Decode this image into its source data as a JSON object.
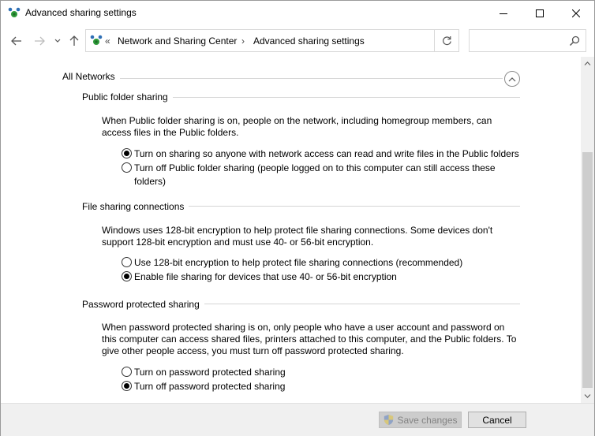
{
  "window": {
    "title": "Advanced sharing settings"
  },
  "address": {
    "overflow": "«",
    "crumbs": [
      "Network and Sharing Center",
      "Advanced sharing settings"
    ],
    "separator": "›"
  },
  "search": {
    "value": "",
    "placeholder": ""
  },
  "profile": {
    "title": "All Networks"
  },
  "sections": [
    {
      "title": "Public folder sharing",
      "description": "When Public folder sharing is on, people on the network, including homegroup members, can access files in the Public folders.",
      "options": [
        {
          "label": "Turn on sharing so anyone with network access can read and write files in the Public folders",
          "selected": true
        },
        {
          "label": "Turn off Public folder sharing (people logged on to this computer can still access these folders)",
          "selected": false
        }
      ]
    },
    {
      "title": "File sharing connections",
      "description": "Windows uses 128-bit encryption to help protect file sharing connections. Some devices don't support 128-bit encryption and must use 40- or 56-bit encryption.",
      "options": [
        {
          "label": "Use 128-bit encryption to help protect file sharing connections (recommended)",
          "selected": false
        },
        {
          "label": "Enable file sharing for devices that use 40- or 56-bit encryption",
          "selected": true
        }
      ]
    },
    {
      "title": "Password protected sharing",
      "description": "When password protected sharing is on, only people who have a user account and password on this computer can access shared files, printers attached to this computer, and the Public folders. To give other people access, you must turn off password protected sharing.",
      "options": [
        {
          "label": "Turn on password protected sharing",
          "selected": false
        },
        {
          "label": "Turn off password protected sharing",
          "selected": true
        }
      ]
    }
  ],
  "footer": {
    "save_label": "Save changes",
    "cancel_label": "Cancel"
  }
}
